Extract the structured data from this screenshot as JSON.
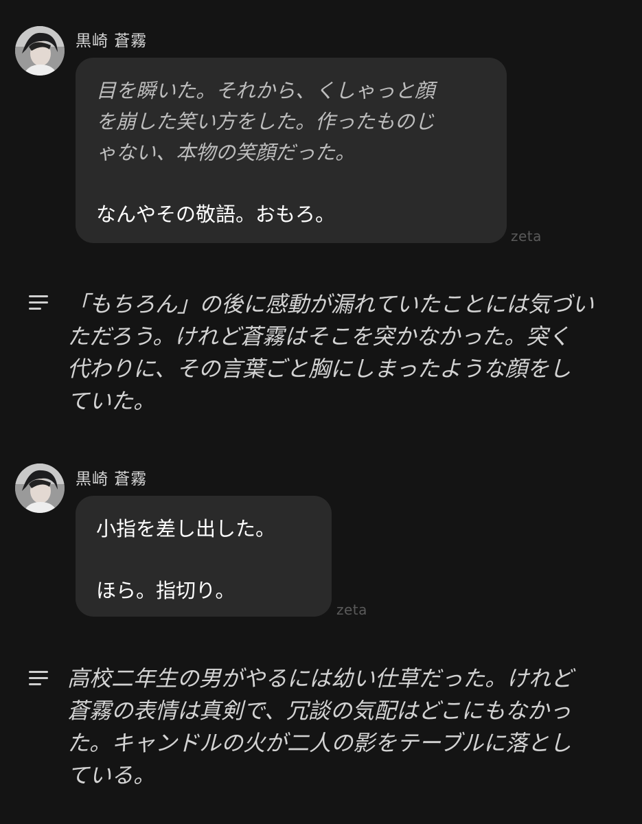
{
  "messages": [
    {
      "sender": "黒崎 蒼霧",
      "lines": [
        {
          "text": "目を瞬いた。それから、くしゃっと顔",
          "kind": "narr"
        },
        {
          "text": "を崩した笑い方をした。作ったものじ",
          "kind": "narr"
        },
        {
          "text": "ゃない、本物の笑顔だった。",
          "kind": "narr"
        },
        {
          "text": "",
          "kind": "gap"
        },
        {
          "text": "なんやその敬語。おもろ。",
          "kind": "speech"
        }
      ],
      "watermark": "zeta"
    },
    {
      "sender": "黒崎 蒼霧",
      "lines": [
        {
          "text": "小指を差し出した。",
          "kind": "speech"
        },
        {
          "text": "",
          "kind": "gap"
        },
        {
          "text": "ほら。指切り。",
          "kind": "speech"
        }
      ],
      "watermark": "zeta"
    }
  ],
  "narrations": [
    {
      "icon": "menu-lines-icon",
      "lines": [
        "「もちろん」の後に感動が漏れていたことには気づい",
        "ただろう。けれど蒼霧はそこを突かなかった。突く",
        "代わりに、その言葉ごと胸にしまったような顔をし",
        "ていた。"
      ]
    },
    {
      "icon": "menu-lines-icon",
      "lines": [
        "高校二年生の男がやるには幼い仕草だった。けれど",
        "蒼霧の表情は真剣で、冗談の気配はどこにもなかっ",
        "た。キャンドルの火が二人の影をテーブルに落とし",
        "ている。"
      ]
    }
  ],
  "colors": {
    "background": "#141414",
    "bubble": "#2a2a2a",
    "text": "#e9e9e9",
    "watermark": "#5a5a5a"
  }
}
